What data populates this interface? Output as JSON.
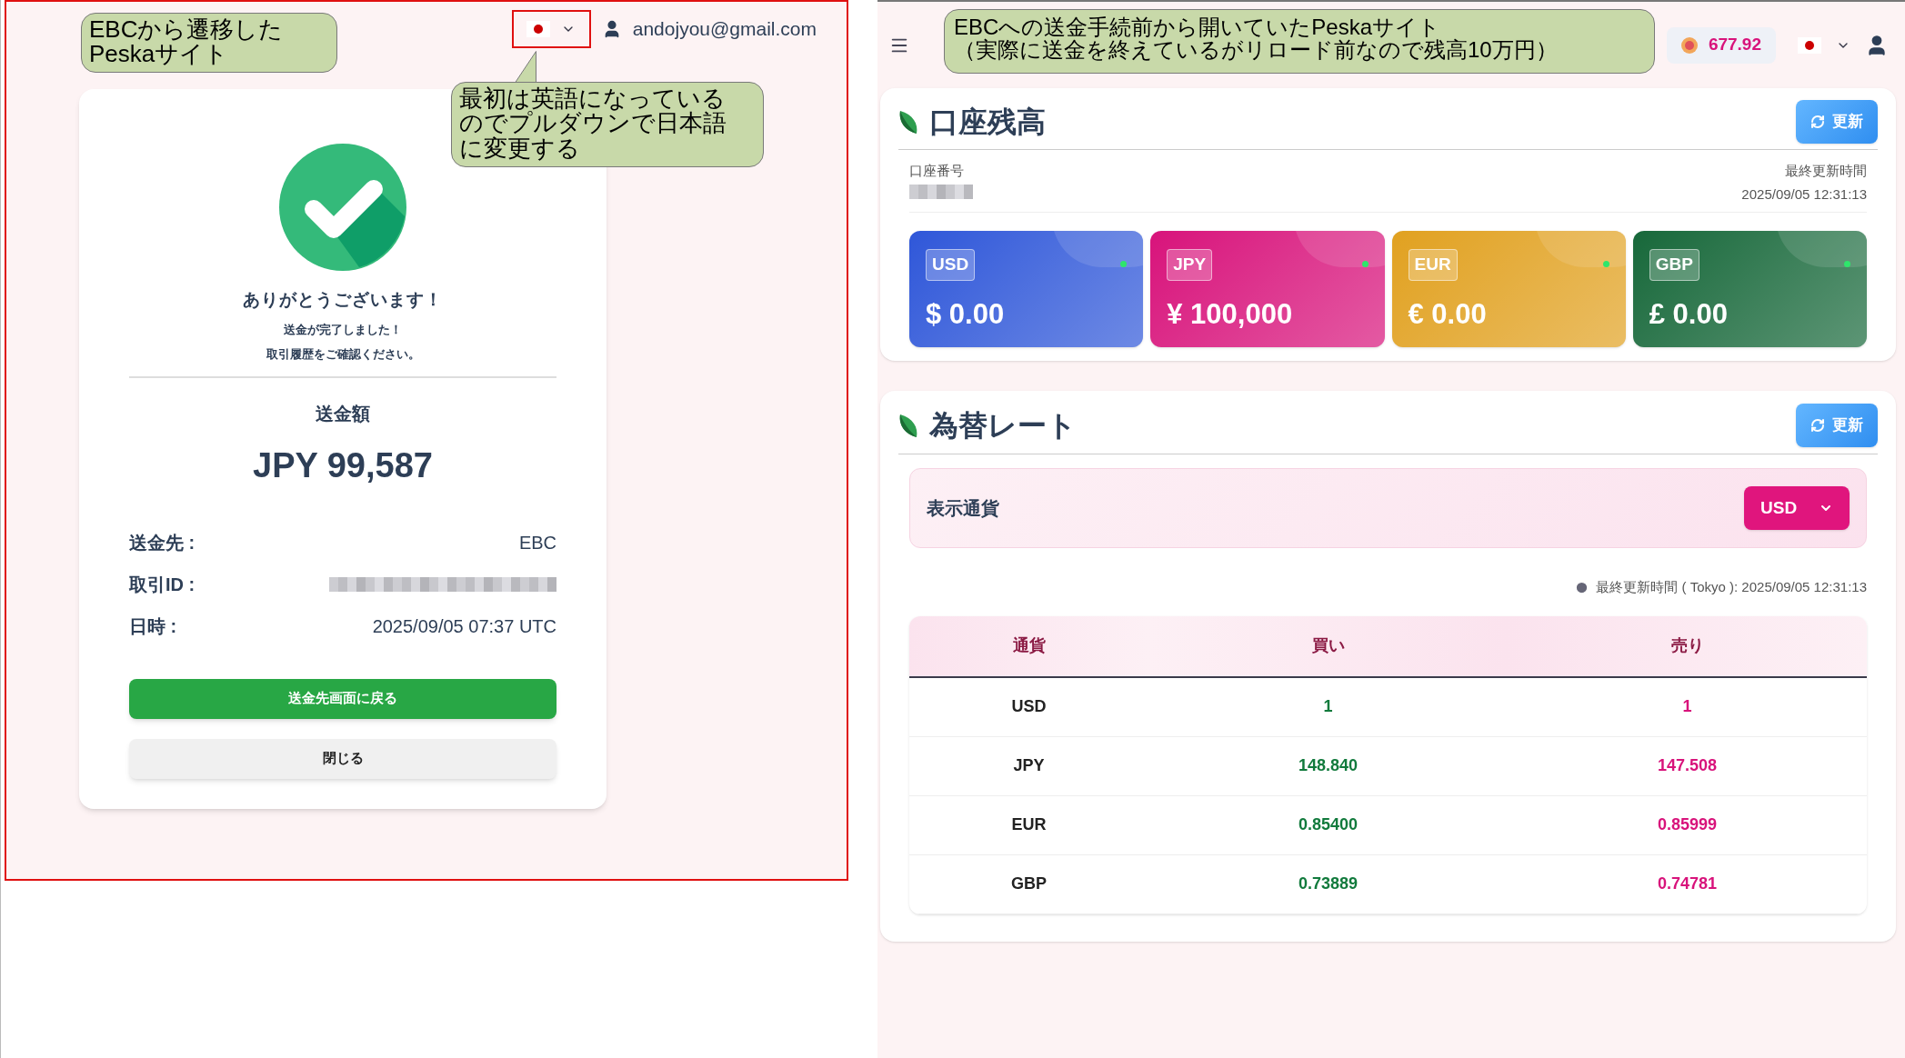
{
  "annotations": [
    {
      "lines": [
        "EBCから遷移した",
        "Peskaサイト"
      ]
    },
    {
      "lines": [
        "最初は英語になっている",
        "のでプルダウンで日本語",
        "に変更する"
      ]
    },
    {
      "lines": [
        "EBCへの送金手続前から開いていたPeskaサイト",
        "（実際に送金を終えているがリロード前なので残高10万円）"
      ]
    }
  ],
  "left_page": {
    "user_email": "andojyou@gmail.com",
    "success_card": {
      "title": "ありがとうございます！",
      "message_lines": [
        "送金が完了しました！",
        "取引履歴をご確認ください。"
      ],
      "amount_label": "送金額",
      "amount": "JPY 99,587",
      "details": [
        {
          "kind": "text",
          "label": "送金先 :",
          "value": "EBC"
        },
        {
          "kind": "redacted",
          "label": "取引ID :"
        },
        {
          "kind": "text",
          "label": "日時 :",
          "value": "2025/09/05 07:37 UTC"
        }
      ],
      "buttons": [
        {
          "kind": "primary",
          "label": "送金先画面に戻る"
        },
        {
          "kind": "secondary",
          "label": "閉じる"
        }
      ]
    }
  },
  "right_page": {
    "points": "677.92",
    "balance_card": {
      "title": "口座残高",
      "refresh": "更新",
      "account_label": "口座番号",
      "updated_label": "最終更新時間",
      "updated_at": "2025/09/05 12:31:13",
      "tiles": [
        {
          "currency": "USD",
          "amount": "$ 0.00",
          "color": "#2f57d9"
        },
        {
          "currency": "JPY",
          "amount": "¥ 100,000",
          "color": "#d8137b"
        },
        {
          "currency": "EUR",
          "amount": "€ 0.00",
          "color": "#e1a120"
        },
        {
          "currency": "GBP",
          "amount": "£ 0.00",
          "color": "#17683a"
        }
      ]
    },
    "rates_card": {
      "title": "為替レート",
      "refresh": "更新",
      "display_label": "表示通貨",
      "display_currency": "USD",
      "updated_note": "最終更新時間 ( Tokyo ): 2025/09/05 12:31:13",
      "columns": [
        "通貨",
        "買い",
        "売り"
      ],
      "rows": [
        {
          "currency": "USD",
          "buy": "1",
          "sell": "1"
        },
        {
          "currency": "JPY",
          "buy": "148.840",
          "sell": "147.508"
        },
        {
          "currency": "EUR",
          "buy": "0.85400",
          "sell": "0.85999"
        },
        {
          "currency": "GBP",
          "buy": "0.73889",
          "sell": "0.74781"
        }
      ]
    }
  }
}
